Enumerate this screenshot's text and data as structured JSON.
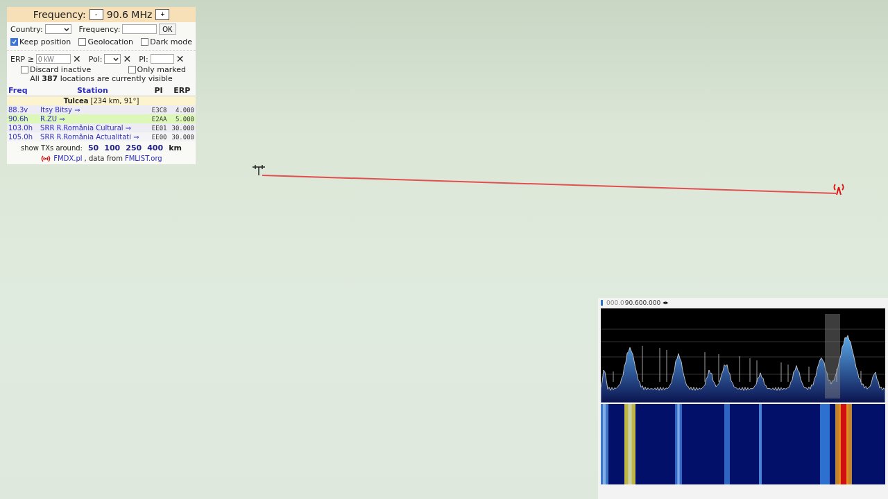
{
  "panel": {
    "frequency_bar": {
      "label": "Frequency:",
      "minus": "-",
      "value": "90.6 MHz",
      "plus": "+"
    },
    "filters": {
      "country_label": "Country:",
      "frequency_label": "Frequency:",
      "ok": "OK",
      "options": [
        {
          "label": "Keep position",
          "checked": true
        },
        {
          "label": "Geolocation",
          "checked": false
        },
        {
          "label": "Dark mode",
          "checked": false
        }
      ],
      "erp_label": "ERP ≥",
      "erp_placeholder": "0 kW",
      "clear": "✕",
      "pol_label": "Pol:",
      "pi_label": "PI:",
      "options_2": [
        {
          "label": "Discard inactive",
          "checked": false
        },
        {
          "label": "Only marked",
          "checked": false
        }
      ],
      "summary": "All **387** locations are currently visible"
    },
    "table": {
      "columns": [
        "Freq",
        "Station",
        "PI",
        "ERP"
      ],
      "group": "**Tulcea** [234 km, 91°]",
      "rows": [
        {
          "freq": "88.3v",
          "station": "Itsy Bitsy ⇒",
          "pi": "E3C8",
          "erp": "4.000",
          "selected": false
        },
        {
          "freq": "90.6h",
          "station": "R.ZU ⇒",
          "pi": "E2AA",
          "erp": "5.000",
          "selected": true
        },
        {
          "freq": "103.0h",
          "station": "SRR R.România Cultural ⇒",
          "pi": "EE01",
          "erp": "30.000",
          "selected": false
        },
        {
          "freq": "105.0h",
          "station": "SRR R.România Actualitati ⇒",
          "pi": "EE00",
          "erp": "30.000",
          "selected": false
        }
      ]
    },
    "radius": {
      "label": "show TXs around:",
      "options": [
        "50",
        "100",
        "250",
        "400"
      ],
      "unit": "km"
    },
    "footer": {
      "site": "FMDX.pl",
      "middle": ", data from",
      "source": "FMLIST.org"
    }
  },
  "sdr": {
    "frequency_prefix": "000.0",
    "frequency": "90.600.000",
    "arrows": "◂▸"
  }
}
